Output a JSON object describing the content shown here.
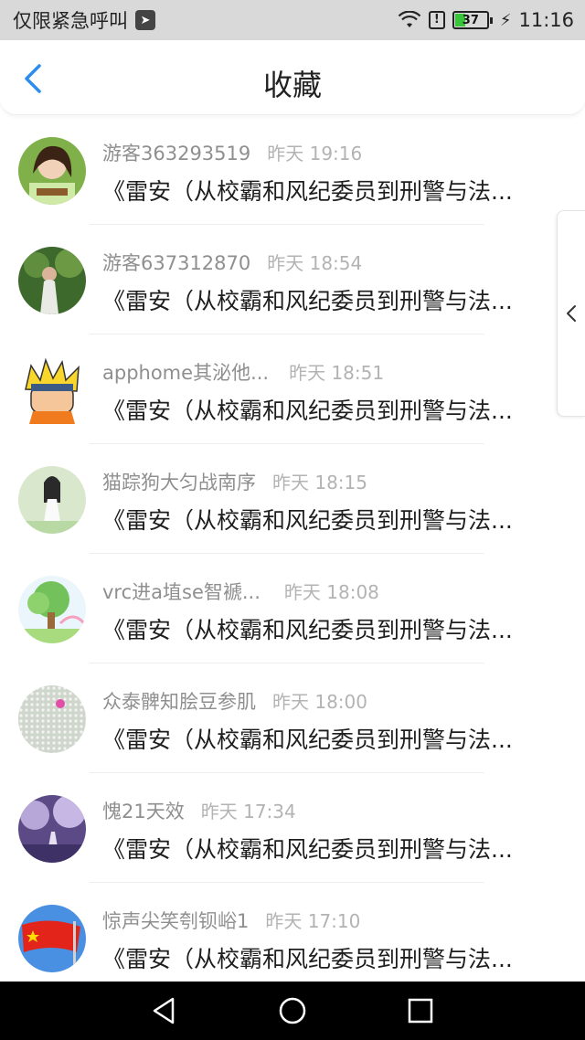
{
  "status_bar": {
    "left_text": "仅限紧急呼叫",
    "battery_level": "37",
    "time": "11:16"
  },
  "header": {
    "title": "收藏"
  },
  "items": [
    {
      "name": "游客363293519",
      "time": "昨天 19:16",
      "content": "《雷安（从校霸和风纪委员到刑警与法..."
    },
    {
      "name": "游客637312870",
      "time": "昨天 18:54",
      "content": "《雷安（从校霸和风纪委员到刑警与法..."
    },
    {
      "name": "apphome其泌他...",
      "time": "昨天 18:51",
      "content": "《雷安（从校霸和风纪委员到刑警与法..."
    },
    {
      "name": "猫踪狗大匀战南序",
      "time": "昨天 18:15",
      "content": "《雷安（从校霸和风纪委员到刑警与法..."
    },
    {
      "name": "vrc进a埴se智褫...",
      "time": "昨天 18:08",
      "content": "《雷安（从校霸和风纪委员到刑警与法..."
    },
    {
      "name": "众泰髀知脍豆参肌",
      "time": "昨天 18:00",
      "content": "《雷安（从校霸和风纪委员到刑警与法..."
    },
    {
      "name": "愧21天效",
      "time": "昨天 17:34",
      "content": "《雷安（从校霸和风纪委员到刑警与法..."
    },
    {
      "name": "惊声尖笑刳钡峪1",
      "time": "昨天 17:10",
      "content": "《雷安（从校霸和风纪委员到刑警与法..."
    }
  ],
  "colors": {
    "accent": "#2d8cf0",
    "battery_fill": "#39c53b"
  }
}
